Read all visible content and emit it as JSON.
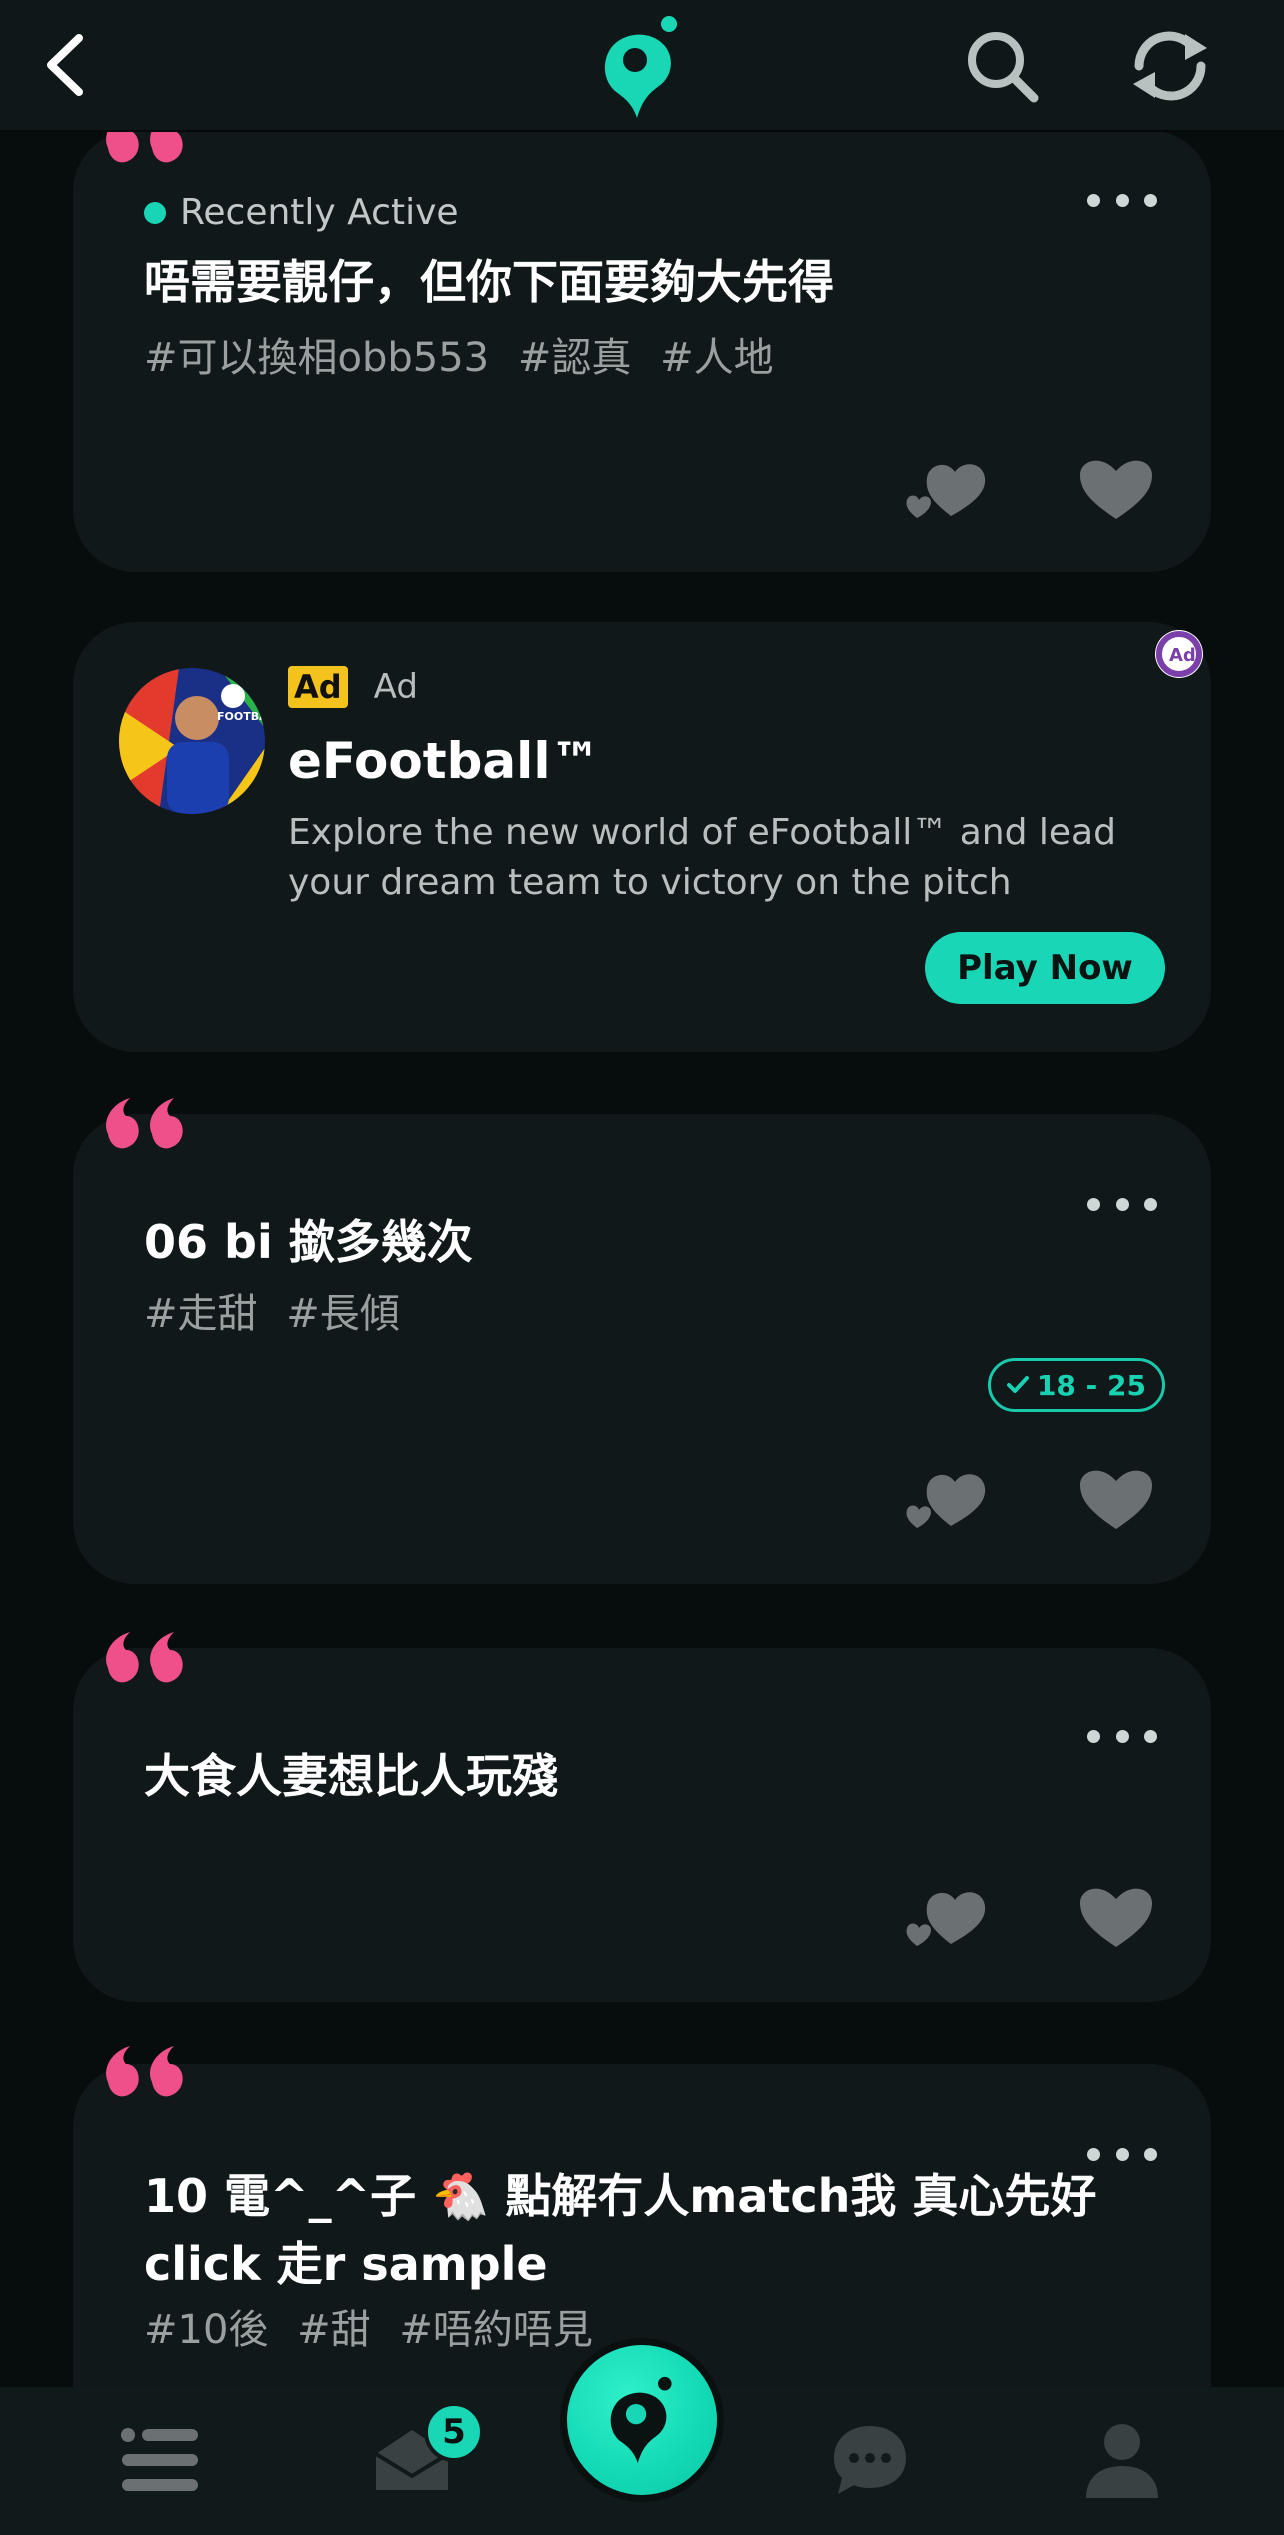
{
  "colors": {
    "accent": "#19d6b5",
    "quote_pink": "#f0508a",
    "card_bg": "#101819",
    "page_bg": "#070c0c"
  },
  "top_bar": {
    "icons": [
      "back-icon",
      "app-logo-icon",
      "search-icon",
      "refresh-icon"
    ]
  },
  "posts": [
    {
      "status": "Recently Active",
      "title": "唔需要靚仔，但你下面要夠大先得",
      "tags": [
        "#可以換相obb553",
        "#認真",
        "#人地"
      ]
    },
    {
      "title": "06 bi 撳多幾次",
      "tags": [
        "#走甜",
        "#長傾"
      ],
      "age_range": "18 - 25"
    },
    {
      "title": "大食人妻想比人玩殘",
      "tags": []
    },
    {
      "title": "10 電^_^子 🐔 點解冇人match我 真心先好click 走r sample",
      "tags": [
        "#10後",
        "#甜",
        "#唔約唔見"
      ]
    }
  ],
  "ad": {
    "chip": "Ad",
    "label": "Ad",
    "title": "eFootball™",
    "description": "Explore the new world of eFootball™ and lead your dream team to victory on the pitch",
    "cta": "Play Now"
  },
  "bottom_nav": {
    "items": [
      "list-icon",
      "inbox-icon",
      "home-logo-icon",
      "chat-icon",
      "profile-icon"
    ],
    "inbox_badge": "5"
  }
}
